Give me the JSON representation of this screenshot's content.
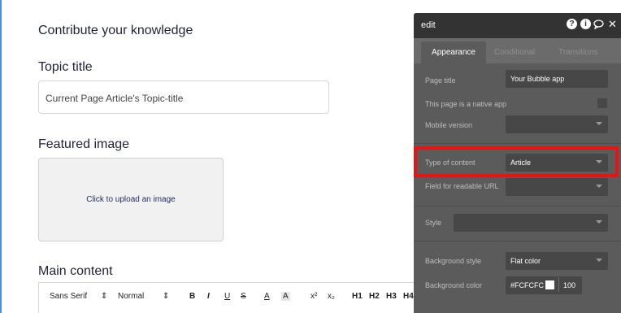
{
  "page": {
    "heading": "Contribute your knowledge",
    "topic_title_label": "Topic title",
    "topic_title_value": "Current Page Article's Topic-title",
    "featured_image_label": "Featured image",
    "upload_prompt": "Click to upload an image",
    "main_content_label": "Main content"
  },
  "toolbar": {
    "font": "Sans Serif",
    "font_arrow": "⇕",
    "size": "Normal",
    "size_arrow": "⇕",
    "bold": "B",
    "italic": "I",
    "underline": "U",
    "strike": "S",
    "text_color": "A",
    "highlight": "A",
    "superscript": "x²",
    "subscript": "x₂",
    "h1": "H1",
    "h2": "H2",
    "h3": "H3",
    "h4": "H4"
  },
  "editor": {
    "title": "edit",
    "icons": [
      "help-icon",
      "info-icon",
      "comment-icon",
      "close-icon"
    ],
    "tabs": [
      {
        "label": "Appearance",
        "active": true
      },
      {
        "label": "Conditional",
        "active": false
      },
      {
        "label": "Transitions",
        "active": false
      }
    ],
    "page_title_label": "Page title",
    "page_title_value": "Your Bubble app",
    "native_app_label": "This page is a native app",
    "mobile_version_label": "Mobile version",
    "mobile_version_value": "",
    "type_of_content_label": "Type of content",
    "type_of_content_value": "Article",
    "readable_url_label": "Field for readable URL",
    "readable_url_value": "",
    "style_label": "Style",
    "style_value": "",
    "background_style_label": "Background style",
    "background_style_value": "Flat color",
    "background_color_label": "Background color",
    "background_color_value": "#FCFCFC",
    "background_opacity": "100"
  },
  "colors": {
    "panel_bg": "#5b5b5b",
    "panel_header": "#333333",
    "highlight_border": "#ee1111",
    "upload_text": "#1e2a5e"
  }
}
